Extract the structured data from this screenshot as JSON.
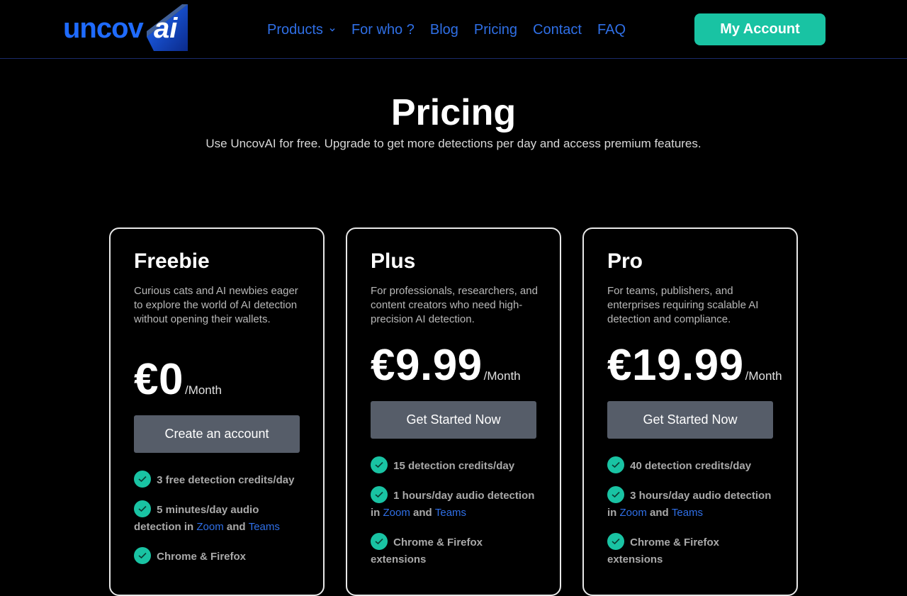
{
  "header": {
    "logo_text": "uncov",
    "logo_ai": "ai",
    "nav": [
      "Products",
      "For who ?",
      "Blog",
      "Pricing",
      "Contact",
      "FAQ"
    ],
    "account_label": "My Account"
  },
  "hero": {
    "title": "Pricing",
    "subtitle": "Use UncovAI for free. Upgrade to get more detections per day and access premium features."
  },
  "plans": [
    {
      "name": "Freebie",
      "desc": "Curious cats and AI newbies eager to explore the world of AI detection without opening their wallets.",
      "price": "€0",
      "per": "/Month",
      "cta": "Create an account",
      "f1": "3 free detection credits/day",
      "f2_pre": "5 minutes/day audio detection in",
      "f2_link1": "Zoom",
      "f2_and": "and",
      "f2_link2": "Teams",
      "f3": "Chrome & Firefox"
    },
    {
      "name": "Plus",
      "desc": "For professionals, researchers, and content creators who need high-precision AI detection.",
      "price": "€9.99",
      "per": "/Month",
      "cta": "Get Started Now",
      "f1": "15 detection credits/day",
      "f2_pre": "1 hours/day audio detection in",
      "f2_link1": "Zoom",
      "f2_and": "and",
      "f2_link2": "Teams",
      "f3": "Chrome & Firefox extensions"
    },
    {
      "name": "Pro",
      "desc": "For teams, publishers, and enterprises requiring scalable AI detection and compliance.",
      "price": "€19.99",
      "per": "/Month",
      "cta": "Get Started Now",
      "f1": "40 detection credits/day",
      "f2_pre": "3 hours/day audio detection in",
      "f2_link1": "Zoom",
      "f2_and": "and",
      "f2_link2": "Teams",
      "f3": "Chrome & Firefox extensions"
    }
  ],
  "colors": {
    "accent": "#19c3a3",
    "link": "#2f6fe6",
    "button": "#565d69"
  }
}
